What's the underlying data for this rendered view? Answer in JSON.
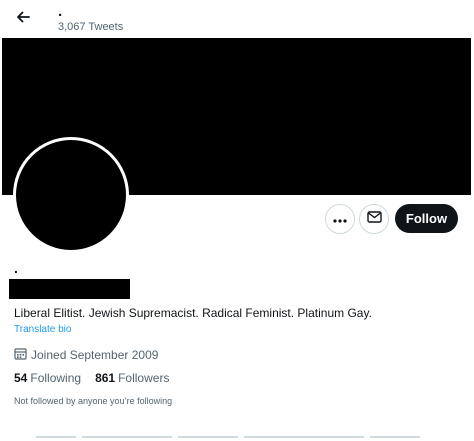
{
  "header": {
    "back_icon": "arrow-left-icon",
    "name": ".",
    "tweet_count": "3,067 Tweets"
  },
  "profile": {
    "name": ".",
    "bio": "Liberal Elitist. Jewish Supremacist. Radical Feminist. Platinum Gay.",
    "translate_label": "Translate bio",
    "joined_icon": "calendar-icon",
    "joined": "Joined September 2009",
    "following_count": "54",
    "following_label": "Following",
    "followers_count": "861",
    "followers_label": "Followers",
    "not_followed_text": "Not followed by anyone you’re following"
  },
  "actions": {
    "more_icon": "more-icon",
    "message_icon": "envelope-icon",
    "follow_label": "Follow"
  },
  "colors": {
    "accent": "#1d9bf0",
    "text_primary": "#0f1419",
    "text_secondary": "#536471",
    "banner": "#000000",
    "follow_button": "#0f1419"
  }
}
